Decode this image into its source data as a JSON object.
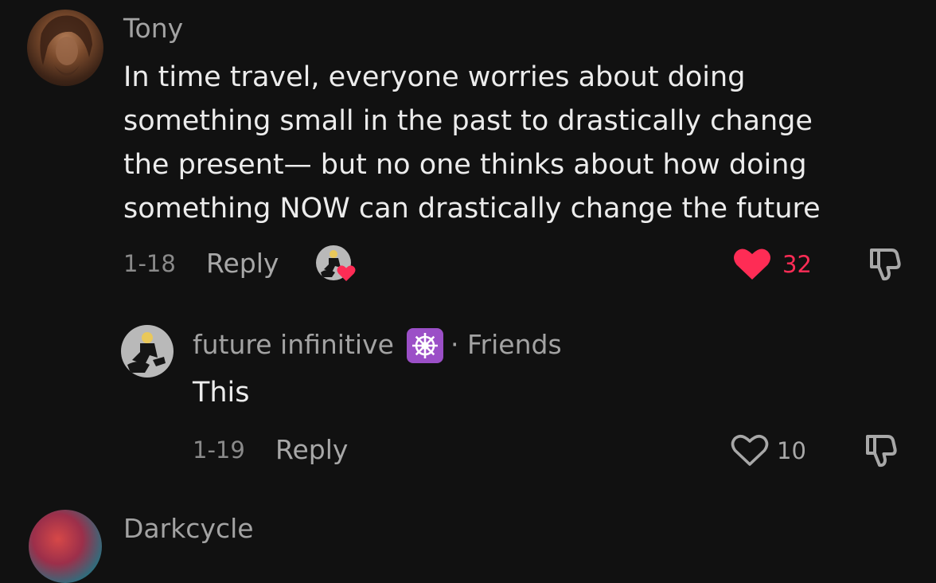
{
  "comments": [
    {
      "username": "Tony",
      "text_lines": [
        "In time travel, everyone worries about doing",
        "something small in the past to drastically change",
        "the present— but no one thinks about how doing",
        "something NOW can drastically change the future"
      ],
      "date": "1-18",
      "reply_label": "Reply",
      "likes": "32",
      "liked": true,
      "creator_liked": true
    }
  ],
  "reply": {
    "username": "future infinitive",
    "badge_icon": "dharma-wheel-icon",
    "relation": "· Friends",
    "text": "This",
    "date": "1-19",
    "reply_label": "Reply",
    "likes": "10",
    "liked": false
  },
  "next_comment": {
    "username": "Darkcycle"
  },
  "colors": {
    "background": "#111111",
    "like_red": "#fe2c55",
    "badge_purple": "#9b4fc7"
  }
}
